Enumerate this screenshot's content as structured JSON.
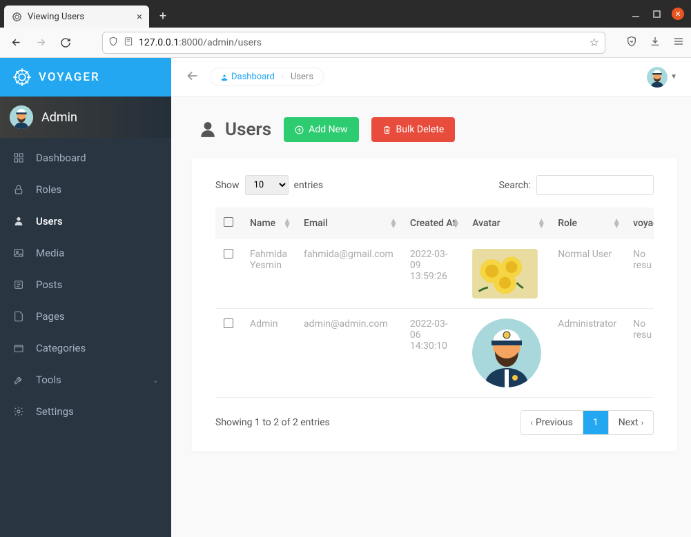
{
  "browser": {
    "tab_title": "Viewing Users",
    "url_host": "127.0.0.1",
    "url_port": ":8000",
    "url_path": "/admin/users"
  },
  "brand": "VOYAGER",
  "profile_name": "Admin",
  "nav": [
    {
      "label": "Dashboard",
      "icon": "dashboard"
    },
    {
      "label": "Roles",
      "icon": "lock"
    },
    {
      "label": "Users",
      "icon": "person",
      "active": true
    },
    {
      "label": "Media",
      "icon": "image"
    },
    {
      "label": "Posts",
      "icon": "news"
    },
    {
      "label": "Pages",
      "icon": "file"
    },
    {
      "label": "Categories",
      "icon": "folder"
    },
    {
      "label": "Tools",
      "icon": "wrench",
      "caret": true
    },
    {
      "label": "Settings",
      "icon": "gear"
    }
  ],
  "breadcrumb": {
    "root": "Dashboard",
    "current": "Users"
  },
  "page_title": "Users",
  "buttons": {
    "add": "Add New",
    "bulk_delete": "Bulk Delete"
  },
  "table": {
    "show_label": "Show",
    "entries_label": "entries",
    "page_size": "10",
    "search_label": "Search:",
    "columns": [
      "",
      "Name",
      "Email",
      "Created At",
      "Avatar",
      "Role",
      "voyag"
    ],
    "rows": [
      {
        "name": "Fahmida Yesmin",
        "email": "fahmida@gmail.com",
        "created_at": "2022-03-09 13:59:26",
        "avatar": "roses",
        "role": "Normal User",
        "extra": "No resu"
      },
      {
        "name": "Admin",
        "email": "admin@admin.com",
        "created_at": "2022-03-06 14:30:10",
        "avatar": "captain",
        "role": "Administrator",
        "extra": "No resu"
      }
    ]
  },
  "footer": {
    "info": "Showing 1 to 2 of 2 entries",
    "prev": "Previous",
    "page": "1",
    "next": "Next"
  }
}
